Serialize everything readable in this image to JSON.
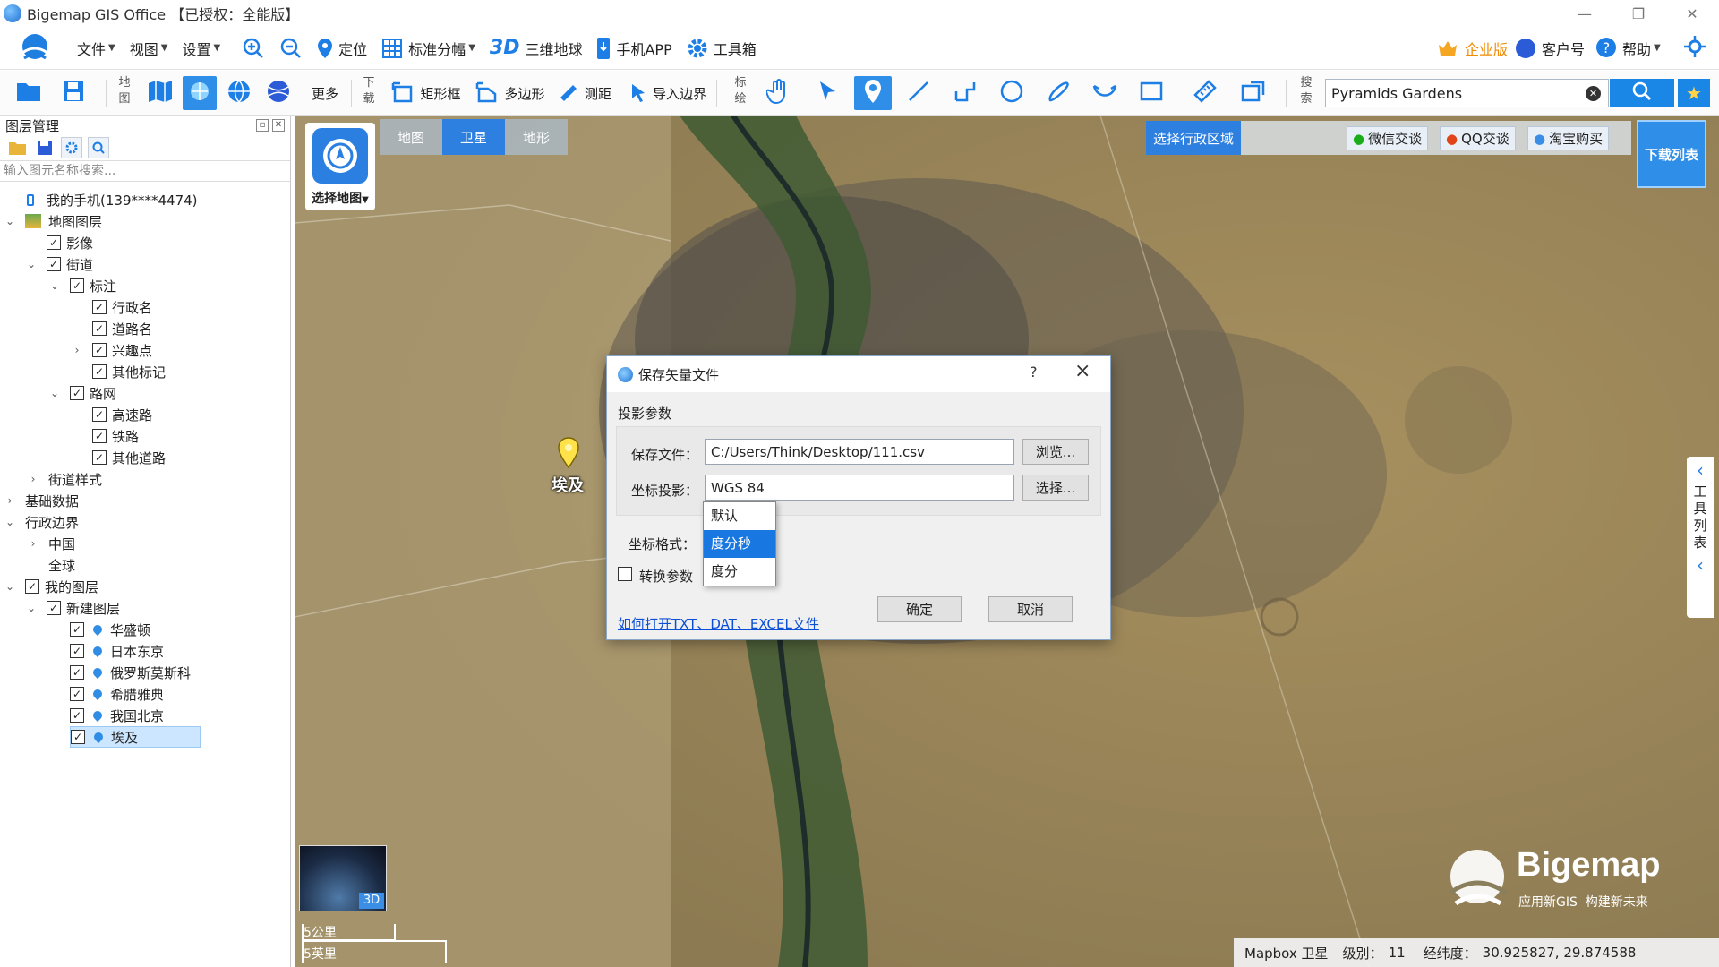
{
  "window": {
    "title": "Bigemap GIS Office 【已授权：全能版】"
  },
  "menu": {
    "file": "文件",
    "view": "视图",
    "settings": "设置"
  },
  "topbar": {
    "locate": "定位",
    "standard_sheet": "标准分幅",
    "threed_badge": "3D",
    "globe_3d": "三维地球",
    "mobile_app": "手机APP",
    "toolbox": "工具箱",
    "enterprise": "企业版",
    "customer": "客户号",
    "help": "帮助"
  },
  "toolbar": {
    "map_label": "地图",
    "more": "更多",
    "download_label": "下载",
    "rect": "矩形框",
    "polygon": "多边形",
    "measure": "测距",
    "import_border": "导入边界",
    "annotate_label": "标绘",
    "search_label": "搜索"
  },
  "search": {
    "value": "Pyramids Gardens"
  },
  "layer_panel": {
    "title": "图层管理",
    "filter_placeholder": "输入图元名称搜索...",
    "items": [
      {
        "label": "我的手机(139****4474)"
      },
      {
        "label": "地图图层"
      },
      {
        "label": "影像"
      },
      {
        "label": "街道"
      },
      {
        "label": "标注"
      },
      {
        "label": "行政名"
      },
      {
        "label": "道路名"
      },
      {
        "label": "兴趣点"
      },
      {
        "label": "其他标记"
      },
      {
        "label": "路网"
      },
      {
        "label": "高速路"
      },
      {
        "label": "铁路"
      },
      {
        "label": "其他道路"
      },
      {
        "label": "街道样式"
      },
      {
        "label": "基础数据"
      },
      {
        "label": "行政边界"
      },
      {
        "label": "中国"
      },
      {
        "label": "全球"
      },
      {
        "label": "我的图层"
      },
      {
        "label": "新建图层"
      },
      {
        "label": "华盛顿"
      },
      {
        "label": "日本东京"
      },
      {
        "label": "俄罗斯莫斯科"
      },
      {
        "label": "希腊雅典"
      },
      {
        "label": "我国北京"
      },
      {
        "label": "埃及"
      }
    ]
  },
  "map": {
    "tabs": [
      "地图",
      "卫星",
      "地形"
    ],
    "active_tab": "卫星",
    "select_map": "选择地图",
    "select_admin_area": "选择行政区域",
    "wechat": "微信交谈",
    "qq": "QQ交谈",
    "taobao": "淘宝购买",
    "download_list": "下载列表",
    "right_tab": [
      "工",
      "具",
      "列",
      "表"
    ],
    "marker_label": "埃及",
    "minimap_badge": "3D",
    "scale_km": "5公里",
    "scale_mi": "5英里",
    "brand": "Bigemap",
    "slogan": "应用新GIS  构建新未来"
  },
  "status": {
    "source": "Mapbox 卫星",
    "level_label": "级别：",
    "level": "11",
    "coord_label": "经纬度：",
    "coords": "30.925827, 29.874588"
  },
  "dialog": {
    "title": "保存矢量文件",
    "help": "?",
    "section": "投影参数",
    "save_file_label": "保存文件：",
    "save_file_value": "C:/Users/Think/Desktop/111.csv",
    "browse": "浏览...",
    "projection_label": "坐标投影：",
    "projection_value": "WGS 84",
    "choose": "选择...",
    "format_label": "坐标格式：",
    "format_options": [
      "默认",
      "度分秒",
      "度分"
    ],
    "format_selected": "度分秒",
    "convert_label": "转换参数",
    "ok": "确定",
    "cancel": "取消",
    "help_link": "如何打开TXT、DAT、EXCEL文件"
  },
  "colors": {
    "accent": "#1a87e6",
    "selected": "#1877e0",
    "tab_active": "#2d7fe0"
  }
}
